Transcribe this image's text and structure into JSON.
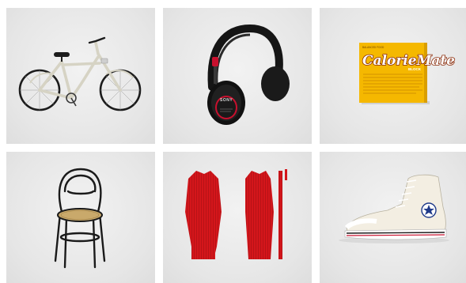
{
  "products": [
    {
      "name": "bicycle",
      "icon": "bicycle-icon"
    },
    {
      "name": "headphones",
      "icon": "headphones-icon",
      "brand_mark": "SONY"
    },
    {
      "name": "calorie-mate-box",
      "icon": "food-box-icon",
      "box_title": "CalorieMate",
      "box_subtitle": "BLOCK",
      "box_topline": "BALANCED FOOD"
    },
    {
      "name": "bentwood-chair",
      "icon": "chair-icon"
    },
    {
      "name": "red-textile-pattern",
      "icon": "fabric-pattern-icon"
    },
    {
      "name": "high-top-sneaker",
      "icon": "sneaker-icon"
    }
  ],
  "colors": {
    "tile_bg": "#e6e6e6",
    "bike_frame": "#d6d3c4",
    "headphone_black": "#151515",
    "headphone_red": "#c8102e",
    "calorie_box": "#f5b800",
    "chair_wood": "#1a1a1a",
    "chair_seat": "#c9a96b",
    "textile_red": "#d4161b",
    "sneaker_canvas": "#f3eee2",
    "sneaker_rubber": "#ffffff"
  }
}
